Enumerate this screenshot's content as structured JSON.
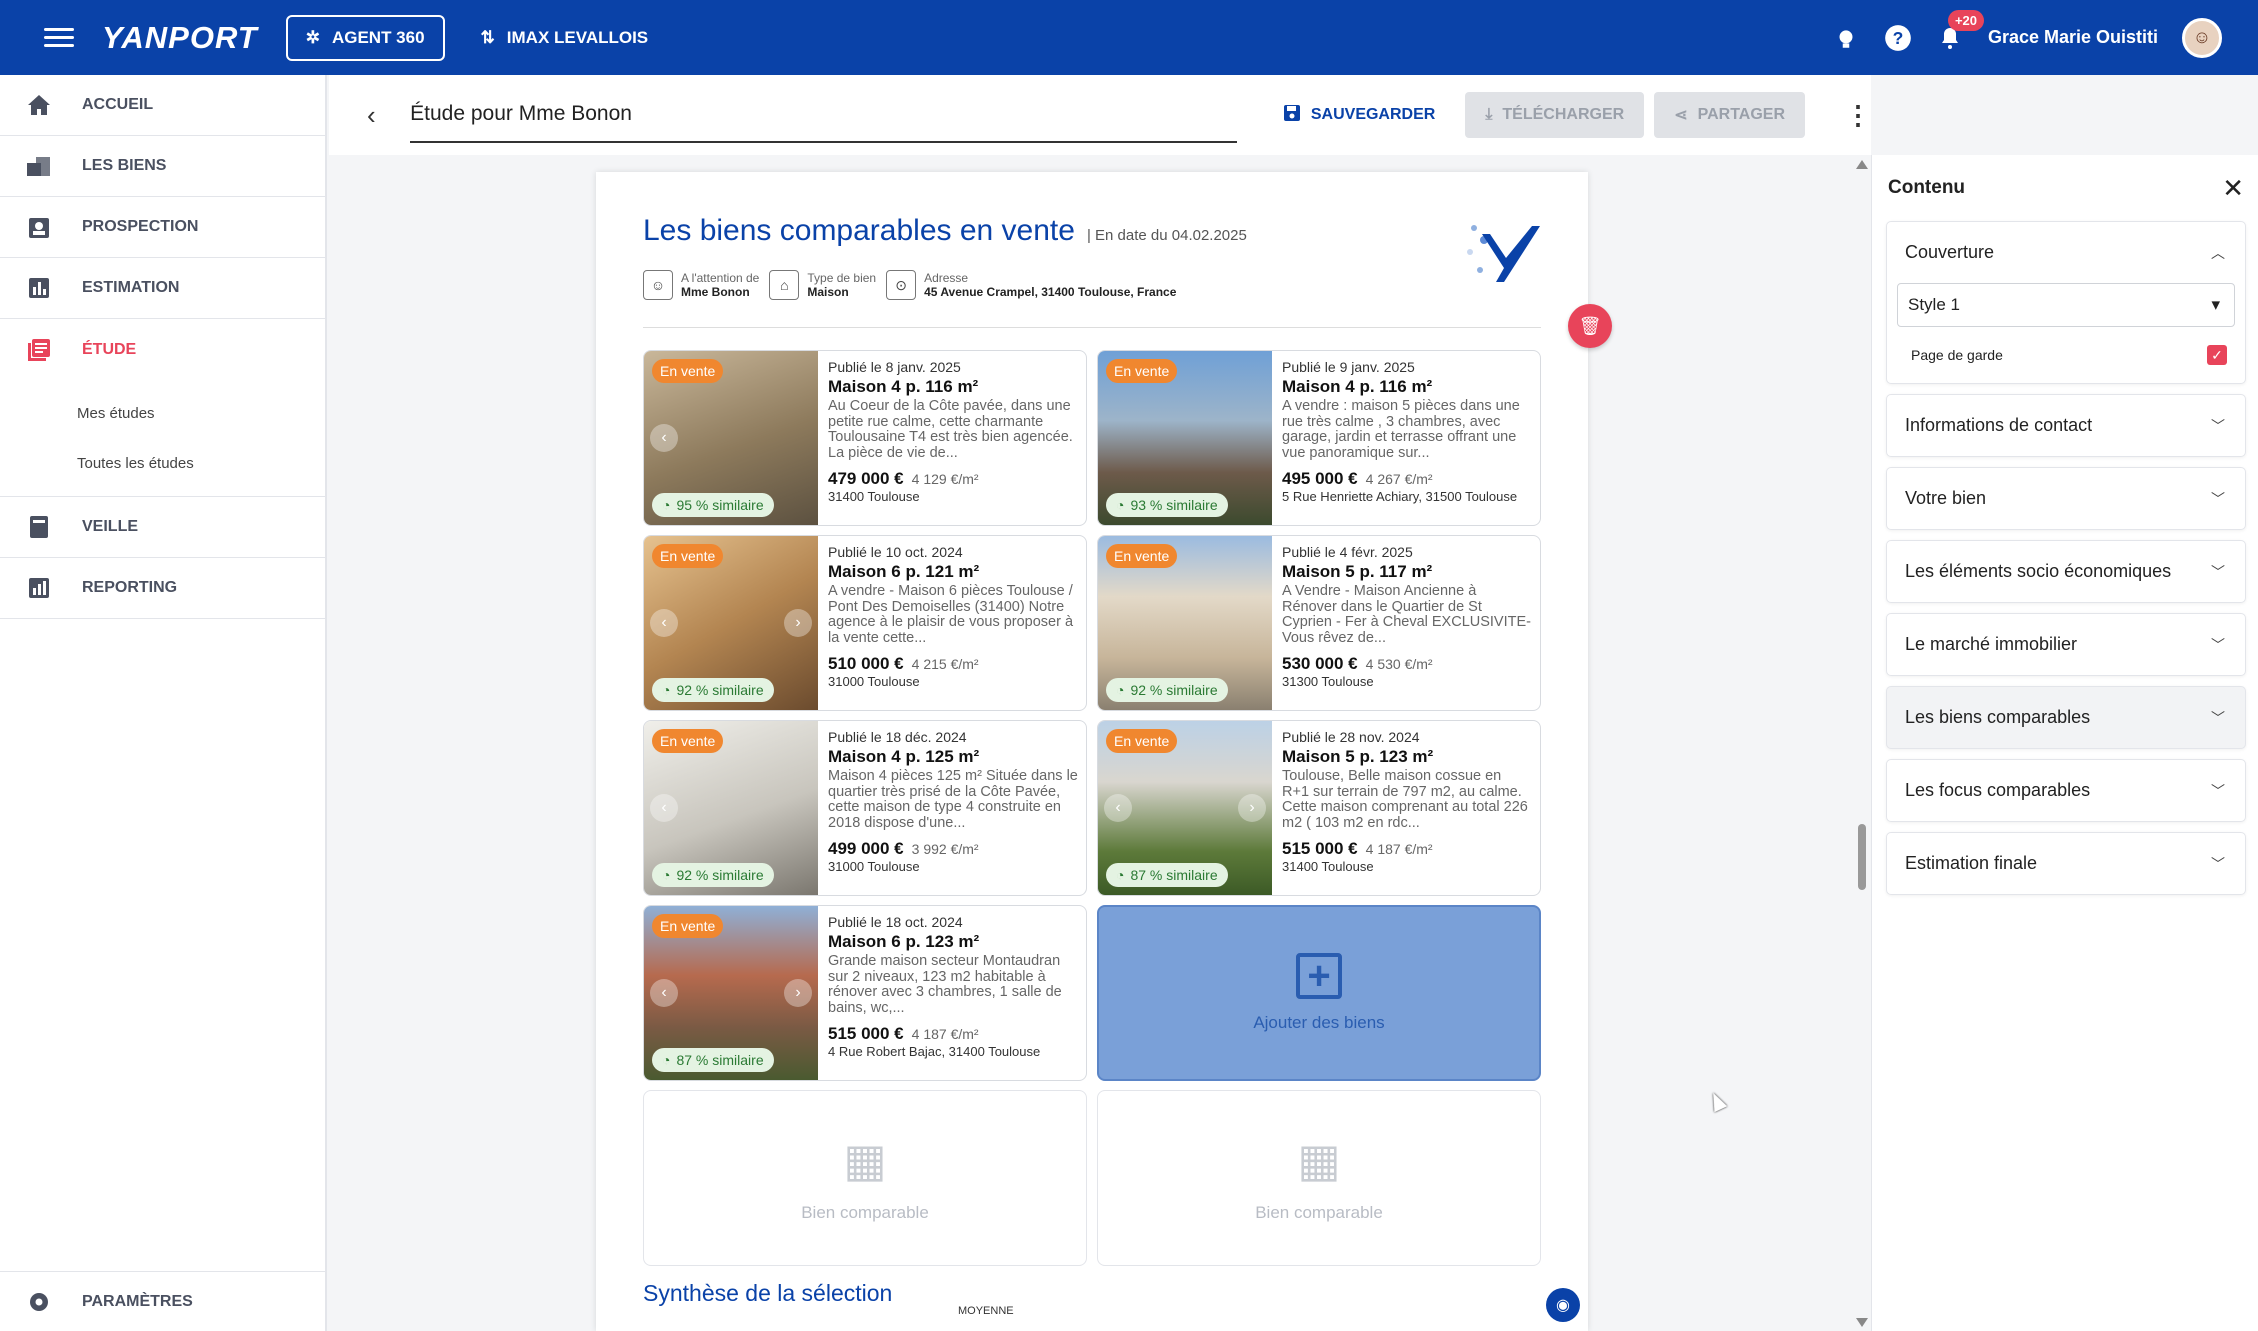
{
  "topbar": {
    "logo": "YANPORT",
    "agent_label": "AGENT 360",
    "agency_label": "IMAX LEVALLOIS",
    "notif_badge": "+20",
    "user_name": "Grace Marie Ouistiti"
  },
  "sidebar": {
    "items": [
      {
        "label": "ACCUEIL",
        "icon": "home-icon"
      },
      {
        "label": "LES BIENS",
        "icon": "properties-icon"
      },
      {
        "label": "PROSPECTION",
        "icon": "prospection-icon"
      },
      {
        "label": "ESTIMATION",
        "icon": "chart-icon"
      },
      {
        "label": "ÉTUDE",
        "icon": "study-icon"
      },
      {
        "label": "VEILLE",
        "icon": "watch-icon"
      },
      {
        "label": "REPORTING",
        "icon": "reporting-icon"
      }
    ],
    "sub_items": [
      "Mes études",
      "Toutes les études"
    ],
    "params": "PARAMÈTRES"
  },
  "header": {
    "title": "Étude pour Mme Bonon",
    "save": "SAUVEGARDER",
    "download": "TÉLÉCHARGER",
    "share": "PARTAGER"
  },
  "doc": {
    "title": "Les biens comparables en vente",
    "date": "En date du 04.02.2025",
    "meta": [
      {
        "label": "A l'attention de",
        "value": "Mme Bonon"
      },
      {
        "label": "Type de bien",
        "value": "Maison"
      },
      {
        "label": "Adresse",
        "value": "45 Avenue Crampel, 31400 Toulouse, France"
      }
    ],
    "cards": [
      {
        "badge": "En vente",
        "sim": "95 % similaire",
        "pub": "Publié le 8 janv. 2025",
        "title": "Maison 4 p. 116 m²",
        "desc": "Au Coeur de la Côte pavée, dans une petite rue calme, cette charmante Toulousaine T4 est très bien agencée. La pièce de vie de...",
        "price": "479 000 €",
        "ppm": "4 129 €/m²",
        "addr": "31400 Toulouse"
      },
      {
        "badge": "En vente",
        "sim": "93 % similaire",
        "pub": "Publié le 9 janv. 2025",
        "title": "Maison 4 p. 116 m²",
        "desc": "A vendre : maison 5 pièces dans une rue très calme , 3 chambres, avec garage, jardin et terrasse offrant une vue panoramique sur...",
        "price": "495 000 €",
        "ppm": "4 267 €/m²",
        "addr": "5 Rue Henriette Achiary, 31500 Toulouse"
      },
      {
        "badge": "En vente",
        "sim": "92 % similaire",
        "pub": "Publié le 10 oct. 2024",
        "title": "Maison 6 p. 121 m²",
        "desc": "A vendre - Maison 6 pièces Toulouse / Pont Des Demoiselles (31400) Notre agence à le plaisir de vous proposer à la vente cette...",
        "price": "510 000 €",
        "ppm": "4 215 €/m²",
        "addr": "31000 Toulouse"
      },
      {
        "badge": "En vente",
        "sim": "92 % similaire",
        "pub": "Publié le 4 févr. 2025",
        "title": "Maison 5 p. 117 m²",
        "desc": "A Vendre - Maison Ancienne à Rénover dans le Quartier de St Cyprien - Fer à Cheval EXCLUSIVITE- Vous rêvez de...",
        "price": "530 000 €",
        "ppm": "4 530 €/m²",
        "addr": "31300 Toulouse"
      },
      {
        "badge": "En vente",
        "sim": "92 % similaire",
        "pub": "Publié le 18 déc. 2024",
        "title": "Maison 4 p. 125 m²",
        "desc": "Maison 4 pièces 125 m² Située dans le quartier très prisé de la Côte Pavée, cette maison de type 4 construite en 2018 dispose d'une...",
        "price": "499 000 €",
        "ppm": "3 992 €/m²",
        "addr": "31000 Toulouse"
      },
      {
        "badge": "En vente",
        "sim": "87 % similaire",
        "pub": "Publié le 28 nov. 2024",
        "title": "Maison 5 p. 123 m²",
        "desc": "Toulouse, Belle maison cossue en R+1 sur terrain de 797 m2, au calme. Cette maison comprenant au total 226 m2 ( 103 m2 en rdc...",
        "price": "515 000 €",
        "ppm": "4 187 €/m²",
        "addr": "31400 Toulouse"
      },
      {
        "badge": "En vente",
        "sim": "87 % similaire",
        "pub": "Publié le 18 oct. 2024",
        "title": "Maison 6 p. 123 m²",
        "desc": "Grande maison secteur Montaudran sur 2 niveaux, 123 m2 habitable à rénover avec 3 chambres, 1 salle de bains, wc,...",
        "price": "515 000 €",
        "ppm": "4 187 €/m²",
        "addr": "4 Rue Robert Bajac, 31400 Toulouse"
      }
    ],
    "add_label": "Ajouter des biens",
    "placeholder_label": "Bien comparable",
    "synthese": "Synthèse de la sélection",
    "moyenne": "MOYENNE"
  },
  "panel": {
    "title": "Contenu",
    "cover": {
      "label": "Couverture",
      "style": "Style 1",
      "check_label": "Page de garde"
    },
    "sections": [
      "Informations de contact",
      "Votre bien",
      "Les éléments socio économiques",
      "Le marché immobilier",
      "Les biens comparables",
      "Les focus comparables",
      "Estimation finale"
    ]
  },
  "colors": {
    "brand": "#0a42a8",
    "accent": "#e8445a",
    "badge_orange": "#f0872f"
  }
}
